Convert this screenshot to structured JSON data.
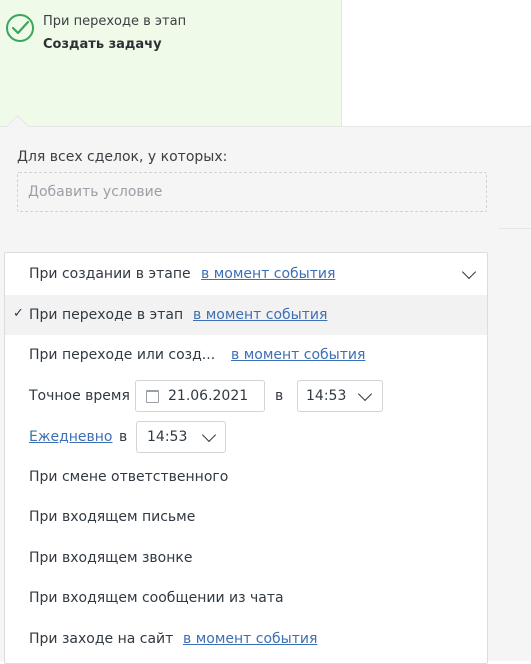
{
  "trigger": {
    "subtitle": "При переходе в этап",
    "title": "Создать задачу"
  },
  "conditions": {
    "label": "Для всех сделок, у которых:",
    "placeholder": "Добавить условие"
  },
  "menu": {
    "items": [
      {
        "label": "При создании в этапе",
        "link": "в момент события"
      },
      {
        "label": "При переходе в этап",
        "link": "в момент события",
        "selected": true
      },
      {
        "label": "При переходе или созд...",
        "link": "в момент события"
      },
      {
        "label": "Точное время",
        "date": "21.06.2021",
        "at": "в",
        "time": "14:53"
      },
      {
        "label": "Ежедневно",
        "at": "в",
        "time": "14:53"
      },
      {
        "label": "При смене ответственного"
      },
      {
        "label": "При входящем письме"
      },
      {
        "label": "При входящем звонке"
      },
      {
        "label": "При входящем сообщении из чата"
      },
      {
        "label": "При заходе на сайт",
        "link": "в момент события"
      }
    ]
  },
  "colors": {
    "trigger_bg": "#effae8",
    "check_green": "#3aa55c",
    "link_blue": "#3d6fb4"
  },
  "icons": [
    "check-circle-icon",
    "checkmark-icon",
    "chevron-down-icon",
    "calendar-icon"
  ]
}
